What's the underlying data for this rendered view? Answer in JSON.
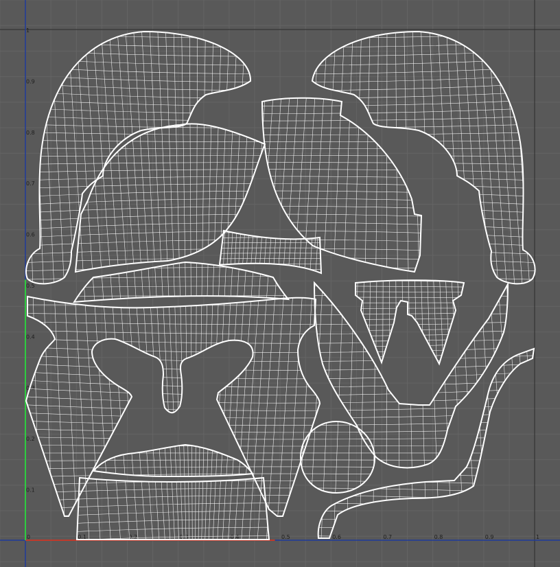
{
  "viewport": {
    "title": "",
    "background": "#595959",
    "grid_color": "#646464",
    "wire_color": "#ffffff",
    "u_axis_color": "#c0392b",
    "v_axis_color": "#2ecc40",
    "border_color": "#1f3a9a"
  },
  "u_ticks": [
    "0",
    "0.1",
    "0.2",
    "0.3",
    "0.4",
    "0.5",
    "0.6",
    "0.7",
    "0.8",
    "0.9",
    "1"
  ],
  "v_ticks": [
    "0",
    "0.1",
    "0.2",
    "0.3",
    "0.4",
    "0.5",
    "0.6",
    "0.7",
    "0.8",
    "0.9",
    "1"
  ],
  "islands": [
    {
      "id": "crest-left",
      "kind": "crest"
    },
    {
      "id": "crest-right",
      "kind": "crest"
    },
    {
      "id": "dome-left",
      "kind": "dome"
    },
    {
      "id": "dome-right",
      "kind": "dome"
    },
    {
      "id": "brow-strip",
      "kind": "strip"
    },
    {
      "id": "upper-band",
      "kind": "band"
    },
    {
      "id": "face-mask",
      "kind": "mask"
    },
    {
      "id": "lower-band",
      "kind": "band"
    },
    {
      "id": "cheek-guard",
      "kind": "cheek"
    },
    {
      "id": "nose-piece",
      "kind": "nose"
    },
    {
      "id": "knob-sphere",
      "kind": "sphere"
    },
    {
      "id": "rim-strap",
      "kind": "strap"
    }
  ]
}
